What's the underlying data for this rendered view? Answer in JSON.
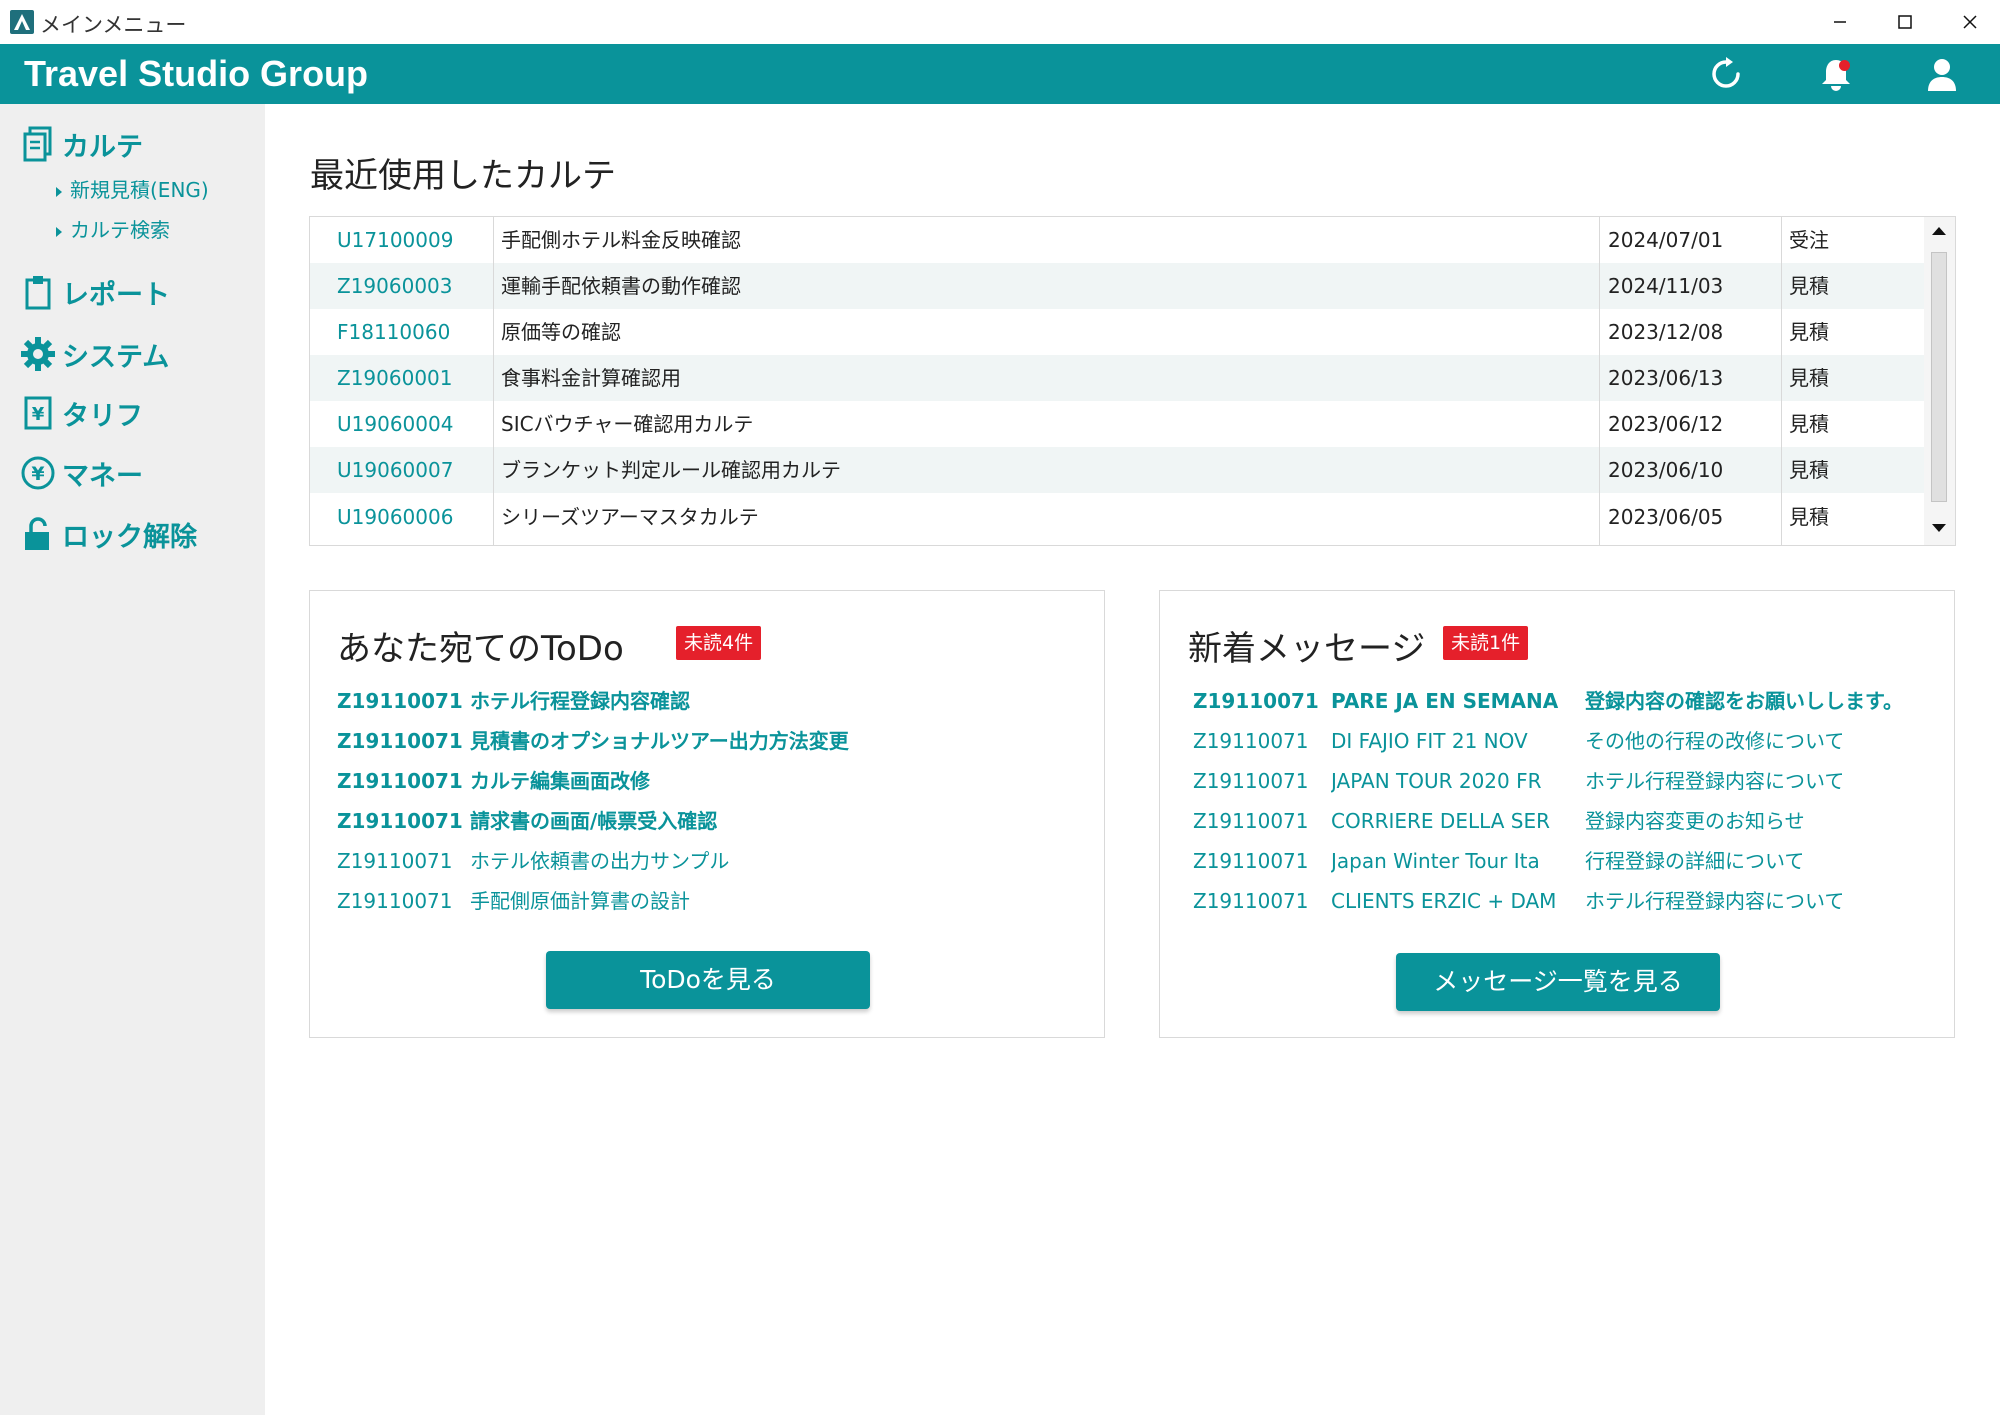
{
  "window": {
    "title": "メインメニュー"
  },
  "header": {
    "brand": "Travel Studio Group"
  },
  "sidebar": {
    "karte": {
      "label": "カルテ",
      "subitems": [
        "新規見積(ENG)",
        "カルテ検索"
      ]
    },
    "items": [
      {
        "label": "レポート",
        "icon": "clipboard-icon"
      },
      {
        "label": "システム",
        "icon": "gear-icon"
      },
      {
        "label": "タリフ",
        "icon": "yen-document-icon"
      },
      {
        "label": "マネー",
        "icon": "yen-circle-icon"
      },
      {
        "label": "ロック解除",
        "icon": "unlock-icon"
      }
    ]
  },
  "recent": {
    "title": "最近使用したカルテ",
    "rows": [
      {
        "id": "U17100009",
        "title": "手配側ホテル料金反映確認",
        "date": "2024/07/01",
        "status": "受注"
      },
      {
        "id": "Z19060003",
        "title": "運輸手配依頼書の動作確認",
        "date": "2024/11/03",
        "status": "見積"
      },
      {
        "id": "F18110060",
        "title": "原価等の確認",
        "date": "2023/12/08",
        "status": "見積"
      },
      {
        "id": "Z19060001",
        "title": "食事料金計算確認用",
        "date": "2023/06/13",
        "status": "見積"
      },
      {
        "id": "U19060004",
        "title": "SICバウチャー確認用カルテ",
        "date": "2023/06/12",
        "status": "見積"
      },
      {
        "id": "U19060007",
        "title": "ブランケット判定ルール確認用カルテ",
        "date": "2023/06/10",
        "status": "見積"
      },
      {
        "id": "U19060006",
        "title": "シリーズツアーマスタカルテ",
        "date": "2023/06/05",
        "status": "見積"
      }
    ]
  },
  "todo": {
    "title": "あなた宛てのToDo",
    "badge": "未読4件",
    "items": [
      {
        "id": "Z19110071",
        "text": "ホテル行程登録内容確認"
      },
      {
        "id": "Z19110071",
        "text": "見積書のオプショナルツアー出力方法変更"
      },
      {
        "id": "Z19110071",
        "text": "カルテ編集画面改修"
      },
      {
        "id": "Z19110071",
        "text": "請求書の画面/帳票受入確認"
      },
      {
        "id": "Z19110071",
        "text": "ホテル依頼書の出力サンプル"
      },
      {
        "id": "Z19110071",
        "text": "手配側原価計算書の設計"
      }
    ],
    "unread_count": 4,
    "button": "ToDoを見る"
  },
  "messages": {
    "title": "新着メッセージ",
    "badge": "未読1件",
    "items": [
      {
        "id": "Z19110071",
        "subject": "PARE JA EN SEMANA",
        "body": "登録内容の確認をお願いしします。"
      },
      {
        "id": "Z19110071",
        "subject": "DI FAJIO FIT 21 NOV",
        "body": "その他の行程の改修について"
      },
      {
        "id": "Z19110071",
        "subject": "JAPAN TOUR 2020 FR",
        "body": "ホテル行程登録内容について"
      },
      {
        "id": "Z19110071",
        "subject": "CORRIERE DELLA SER",
        "body": "登録内容変更のお知らせ"
      },
      {
        "id": "Z19110071",
        "subject": "Japan Winter Tour Ita",
        "body": "行程登録の詳細について"
      },
      {
        "id": "Z19110071",
        "subject": "CLIENTS ERZIC + DAM",
        "body": "ホテル行程登録内容について"
      }
    ],
    "unread_count": 1,
    "button": "メッセージ一覧を見る"
  },
  "colors": {
    "accent": "#0a939a",
    "badge": "#e5202b",
    "sidebar_bg": "#efefef"
  }
}
